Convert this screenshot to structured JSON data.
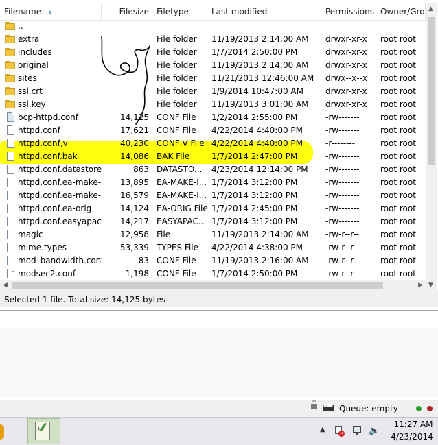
{
  "columns": {
    "filename": "Filename",
    "filesize": "Filesize",
    "filetype": "Filetype",
    "last_modified": "Last modified",
    "permissions": "Permissions",
    "owner_group": "Owner/Gro..."
  },
  "files": [
    {
      "name": "..",
      "size": "",
      "type": "",
      "modified": "",
      "perms": "",
      "owner": "",
      "icon": "folder-icon"
    },
    {
      "name": "extra",
      "size": "",
      "type": "File folder",
      "modified": "11/19/2013 2:14:00 AM",
      "perms": "drwxr-xr-x",
      "owner": "root root",
      "icon": "folder-icon"
    },
    {
      "name": "includes",
      "size": "",
      "type": "File folder",
      "modified": "1/7/2014 2:50:00 PM",
      "perms": "drwxr-xr-x",
      "owner": "root root",
      "icon": "folder-icon"
    },
    {
      "name": "original",
      "size": "",
      "type": "File folder",
      "modified": "11/19/2013 2:14:00 AM",
      "perms": "drwxr-xr-x",
      "owner": "root root",
      "icon": "folder-icon"
    },
    {
      "name": "sites",
      "size": "",
      "type": "File folder",
      "modified": "11/21/2013 12:46:00 AM",
      "perms": "drwx--x--x",
      "owner": "root root",
      "icon": "folder-icon"
    },
    {
      "name": "ssl.crt",
      "size": "",
      "type": "File folder",
      "modified": "1/9/2014 10:47:00 AM",
      "perms": "drwxr-xr-x",
      "owner": "root root",
      "icon": "folder-icon"
    },
    {
      "name": "ssl.key",
      "size": "",
      "type": "File folder",
      "modified": "11/19/2013 3:01:00 AM",
      "perms": "drwxr-xr-x",
      "owner": "root root",
      "icon": "folder-icon"
    },
    {
      "name": "bcp-httpd.conf",
      "size": "14,125",
      "type": "CONF File",
      "modified": "1/2/2014 2:55:00 PM",
      "perms": "-rw-------",
      "owner": "root root",
      "icon": "conf-file-icon"
    },
    {
      "name": "httpd.conf",
      "size": "17,621",
      "type": "CONF File",
      "modified": "4/22/2014 4:40:00 PM",
      "perms": "-rw-------",
      "owner": "root root",
      "icon": "file-icon"
    },
    {
      "name": "httpd.conf,v",
      "size": "40,230",
      "type": "CONF,V File",
      "modified": "4/22/2014 4:40:00 PM",
      "perms": "-r--------",
      "owner": "root root",
      "icon": "file-icon"
    },
    {
      "name": "httpd.conf.bak",
      "size": "14,086",
      "type": "BAK File",
      "modified": "1/7/2014 2:47:00 PM",
      "perms": "-rw-------",
      "owner": "root root",
      "icon": "file-icon"
    },
    {
      "name": "httpd.conf.datastore",
      "size": "863",
      "type": "DATASTO...",
      "modified": "4/23/2014 12:14:00 PM",
      "perms": "-rw-------",
      "owner": "root root",
      "icon": "file-icon"
    },
    {
      "name": "httpd.conf.ea-make-...",
      "size": "13,895",
      "type": "EA-MAKE-I...",
      "modified": "1/7/2014 3:12:00 PM",
      "perms": "-rw-------",
      "owner": "root root",
      "icon": "file-icon"
    },
    {
      "name": "httpd.conf.ea-make-...",
      "size": "16,579",
      "type": "EA-MAKE-I...",
      "modified": "1/7/2014 3:12:00 PM",
      "perms": "-rw-------",
      "owner": "root root",
      "icon": "file-icon"
    },
    {
      "name": "httpd.conf.ea-orig",
      "size": "14,124",
      "type": "EA-ORIG File",
      "modified": "1/7/2014 2:45:00 PM",
      "perms": "-rw-------",
      "owner": "root root",
      "icon": "file-icon"
    },
    {
      "name": "httpd.conf.easyapac...",
      "size": "14,217",
      "type": "EASYAPAC...",
      "modified": "1/7/2014 3:12:00 PM",
      "perms": "-rw-------",
      "owner": "root root",
      "icon": "file-icon"
    },
    {
      "name": "magic",
      "size": "12,958",
      "type": "File",
      "modified": "11/19/2013 2:14:00 AM",
      "perms": "-rw-r--r--",
      "owner": "root root",
      "icon": "file-icon"
    },
    {
      "name": "mime.types",
      "size": "53,339",
      "type": "TYPES File",
      "modified": "4/22/2014 4:38:00 PM",
      "perms": "-rw-r--r--",
      "owner": "root root",
      "icon": "file-icon"
    },
    {
      "name": "mod_bandwidth.conf",
      "size": "83",
      "type": "CONF File",
      "modified": "11/19/2013 2:16:00 AM",
      "perms": "-rw-r--r--",
      "owner": "root root",
      "icon": "file-icon"
    },
    {
      "name": "modsec2.conf",
      "size": "1,198",
      "type": "CONF File",
      "modified": "1/7/2014 2:50:00 PM",
      "perms": "-rw-r--r--",
      "owner": "root root",
      "icon": "file-icon"
    }
  ],
  "status": {
    "selection": "Selected 1 file. Total size: 14,125 bytes",
    "queue": "Queue: empty"
  },
  "taskbar": {
    "time": "11:27 AM",
    "date": "4/23/2014"
  },
  "colors": {
    "highlight": "#ffff00",
    "folder": "#f2c53d",
    "led_green": "#2a9d2a",
    "led_red": "#b02020"
  }
}
